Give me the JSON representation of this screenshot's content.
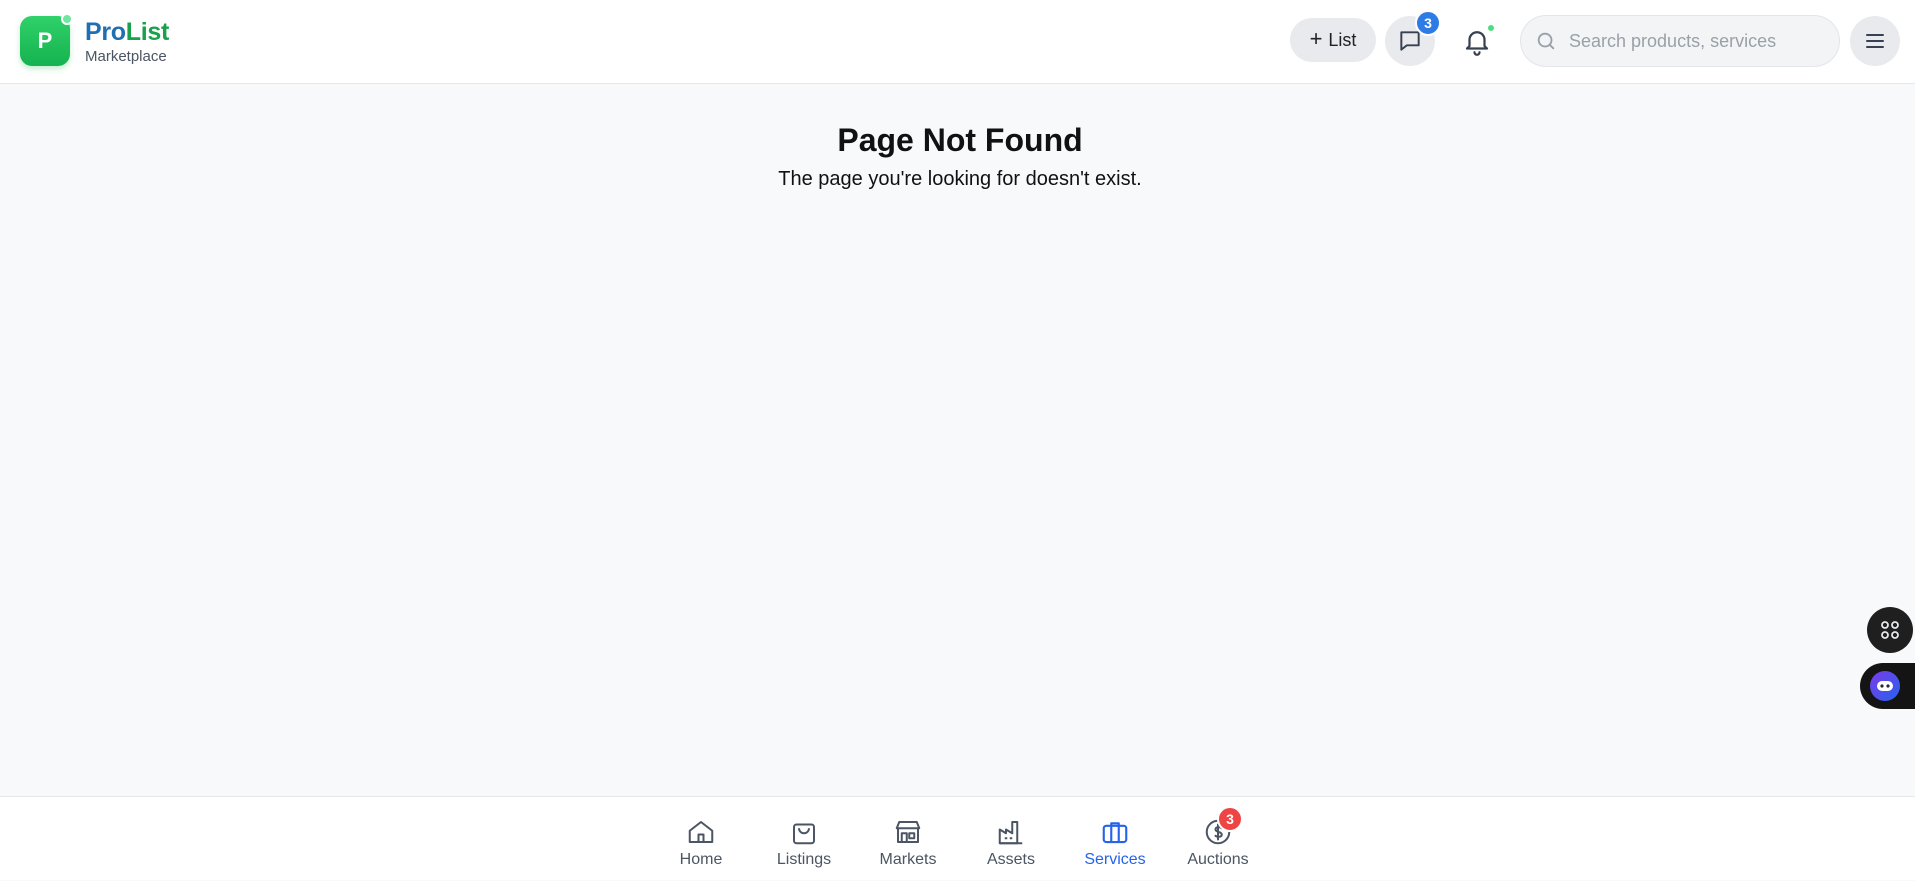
{
  "header": {
    "logo_letter": "P",
    "brand_part1": "Pro",
    "brand_part2": "List",
    "brand_sub": "Marketplace",
    "list_button_label": "List",
    "messages_badge": "3",
    "search_placeholder": "Search products, services"
  },
  "main": {
    "title": "Page Not Found",
    "message": "The page you're looking for doesn't exist."
  },
  "bottom_nav": {
    "items": [
      {
        "label": "Home",
        "icon": "home-icon"
      },
      {
        "label": "Listings",
        "icon": "shopping-bag-icon"
      },
      {
        "label": "Markets",
        "icon": "store-icon"
      },
      {
        "label": "Assets",
        "icon": "factory-icon"
      },
      {
        "label": "Services",
        "icon": "briefcase-icon",
        "active": true
      },
      {
        "label": "Auctions",
        "icon": "dollar-circle-icon",
        "badge": "3"
      }
    ]
  },
  "colors": {
    "brand_blue": "#1f6fb2",
    "brand_green": "#19a04a",
    "active_nav": "#2563eb",
    "badge_blue": "#2f7be6",
    "badge_red": "#ef4444"
  }
}
